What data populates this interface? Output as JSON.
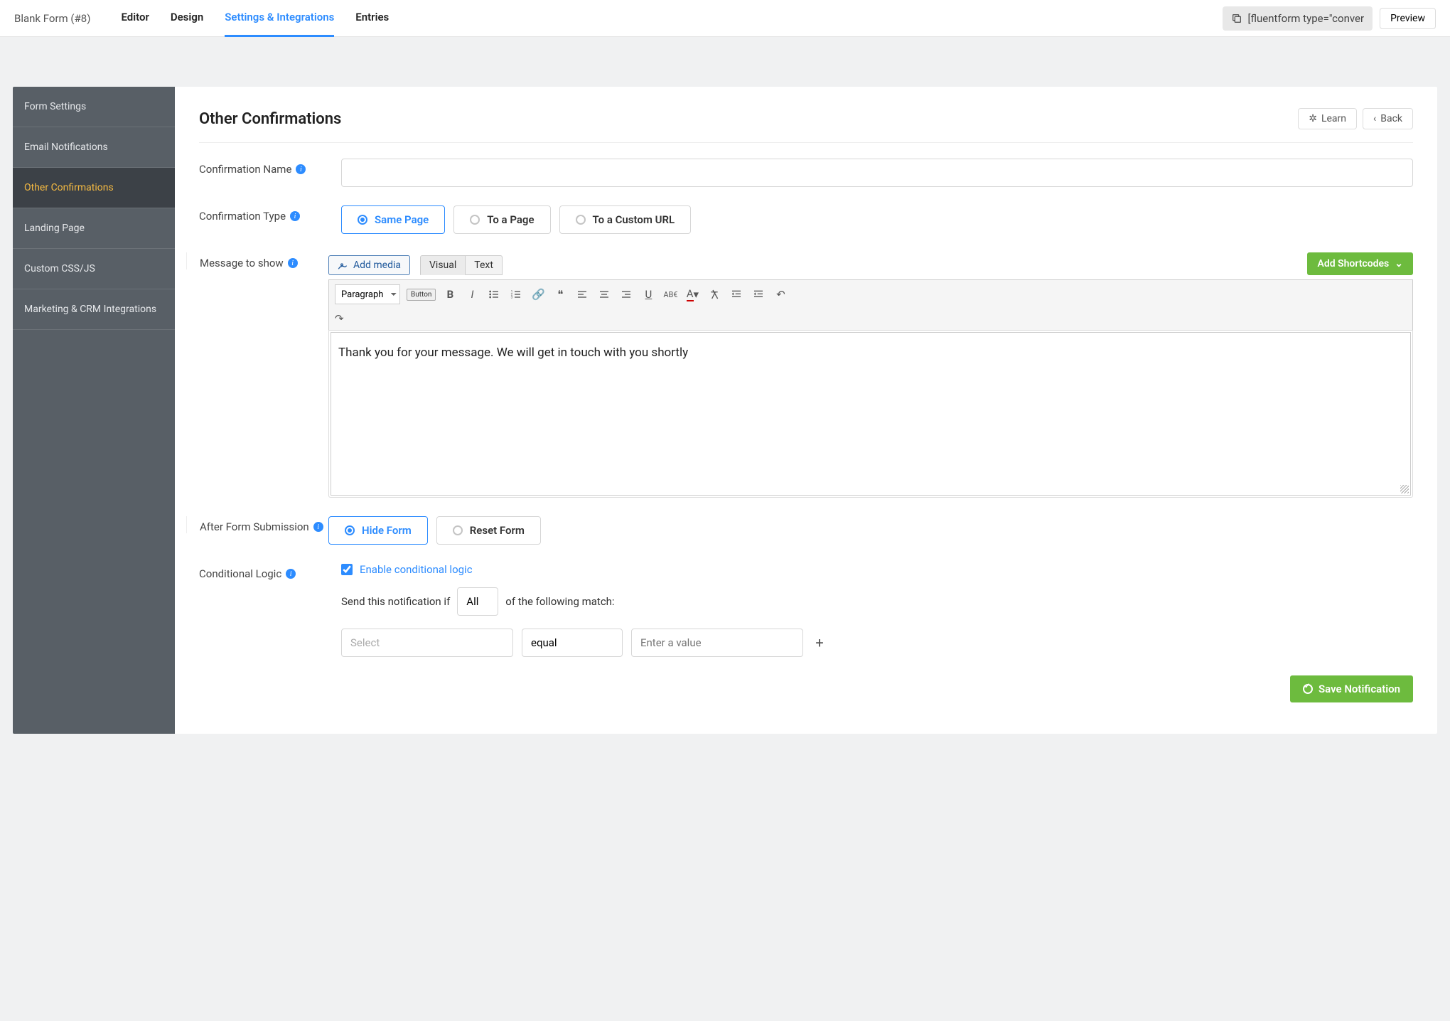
{
  "topbar": {
    "form_name": "Blank Form (#8)",
    "tabs": [
      "Editor",
      "Design",
      "Settings & Integrations",
      "Entries"
    ],
    "active_tab": 2,
    "shortcode": "[fluentform type=\"conver",
    "preview": "Preview"
  },
  "sidebar": {
    "items": [
      "Form Settings",
      "Email Notifications",
      "Other Confirmations",
      "Landing Page",
      "Custom CSS/JS",
      "Marketing & CRM Integrations"
    ],
    "active": 2
  },
  "page": {
    "title": "Other Confirmations",
    "learn": "Learn",
    "back": "Back"
  },
  "fields": {
    "confirmation_name_label": "Confirmation Name",
    "confirmation_name_value": "",
    "confirmation_type_label": "Confirmation Type",
    "confirmation_type_options": [
      "Same Page",
      "To a Page",
      "To a Custom URL"
    ],
    "confirmation_type_selected": 0,
    "message_label": "Message to show",
    "add_media": "Add media",
    "editor_tabs": [
      "Visual",
      "Text"
    ],
    "editor_tab_active": 0,
    "add_shortcodes": "Add Shortcodes",
    "paragraph_select": "Paragraph",
    "button_chip": "Button",
    "message_body": "Thank you for your message. We will get in touch with you shortly",
    "after_submit_label": "After Form Submission",
    "after_submit_options": [
      "Hide Form",
      "Reset Form"
    ],
    "after_submit_selected": 0,
    "conditional_label": "Conditional Logic",
    "enable_conditional": "Enable conditional logic",
    "enable_conditional_checked": true,
    "send_if_prefix": "Send this notification if",
    "send_if_suffix": "of the following match:",
    "match_scope": "All",
    "cond_field_placeholder": "Select",
    "cond_operator": "equal",
    "cond_value_placeholder": "Enter a value",
    "save_button": "Save Notification"
  }
}
